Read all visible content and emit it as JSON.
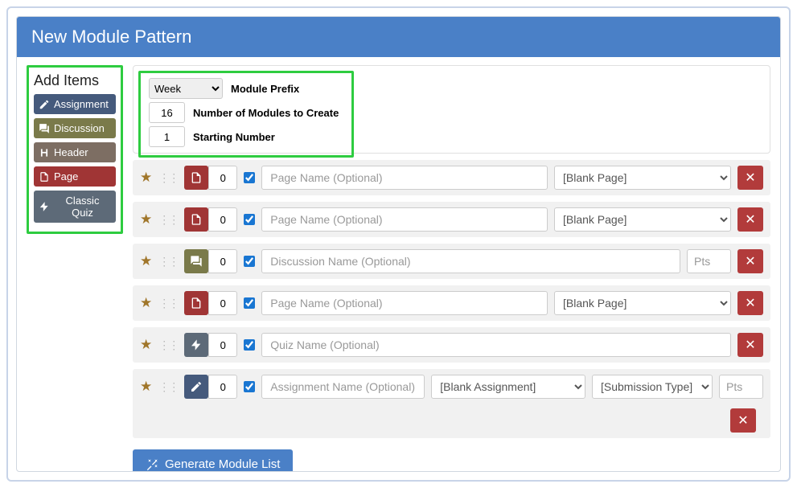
{
  "header": {
    "title": "New Module Pattern"
  },
  "sidebar": {
    "title": "Add Items",
    "items": [
      {
        "label": "Assignment"
      },
      {
        "label": "Discussion"
      },
      {
        "label": "Header"
      },
      {
        "label": "Page"
      },
      {
        "label": "Classic Quiz"
      }
    ]
  },
  "config": {
    "prefix_select": "Week",
    "prefix_label": "Module Prefix",
    "count_value": "16",
    "count_label": "Number of Modules to Create",
    "start_value": "1",
    "start_label": "Starting Number"
  },
  "rows": [
    {
      "indent": "0",
      "name_ph": "Page Name (Optional)",
      "sel": "[Blank Page]"
    },
    {
      "indent": "0",
      "name_ph": "Page Name (Optional)",
      "sel": "[Blank Page]"
    },
    {
      "indent": "0",
      "name_ph": "Discussion Name (Optional)",
      "pts_ph": "Pts"
    },
    {
      "indent": "0",
      "name_ph": "Page Name (Optional)",
      "sel": "[Blank Page]"
    },
    {
      "indent": "0",
      "name_ph": "Quiz Name (Optional)"
    },
    {
      "indent": "0",
      "name_ph": "Assignment Name (Optional)",
      "sel": "[Blank Assignment]",
      "sub_ph": "[Submission Type]",
      "pts_ph": "Pts"
    }
  ],
  "generate_label": "Generate Module List"
}
